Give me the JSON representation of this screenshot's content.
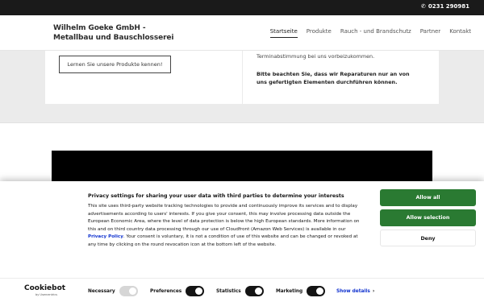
{
  "topbar": {
    "phone_icon": "phone-icon",
    "phone": "0231 290981"
  },
  "header": {
    "logo_line1": "Wilhelm Goeke GmbH -",
    "logo_line2": "Metallbau und Bauschlosserei",
    "nav": [
      "Startseite",
      "Produkte",
      "Rauch - und Brandschutz",
      "Partner",
      "Kontakt"
    ],
    "active_nav": "Startseite"
  },
  "content": {
    "learn_button": "Lernen Sie unsere Produkte kennen!",
    "right_text1": "Terminabstimmung bei uns vorbeizukommen.",
    "right_text2": "Bitte beachten Sie, dass wir Reparaturen nur an von uns gefertigten Elementen durchführen können."
  },
  "cookie": {
    "title": "Privacy settings for sharing your user data with third parties to determine your interests",
    "body_part1": "This site uses third-party website tracking technologies to provide and continuously improve its services and to display advertisements according to users' interests. If you give your consent, this may involve processing data outside the European Economic Area, where the level of data protection is below the high European standards. More information on this and on third country data processing through our use of Cloudfront (Amazon Web Services) is available in our ",
    "privacy_link": "Privacy Policy",
    "body_part2": ". Your consent is voluntary, it is not a condition of use of this website and can be changed or revoked at any time by clicking on the round revocation icon at the bottom left of the website.",
    "allow_all": "Allow all",
    "allow_selection": "Allow selection",
    "deny": "Deny",
    "logo_text": "Cookiebot",
    "logo_sub": "by Usercentrics",
    "toggles": [
      {
        "label": "Necessary",
        "on": true,
        "disabled": true
      },
      {
        "label": "Preferences",
        "on": true,
        "disabled": false
      },
      {
        "label": "Statistics",
        "on": true,
        "disabled": false
      },
      {
        "label": "Marketing",
        "on": true,
        "disabled": false
      }
    ],
    "show_details": "Show details",
    "colors": {
      "accent": "#2a7a32",
      "link": "#1032cf"
    }
  }
}
